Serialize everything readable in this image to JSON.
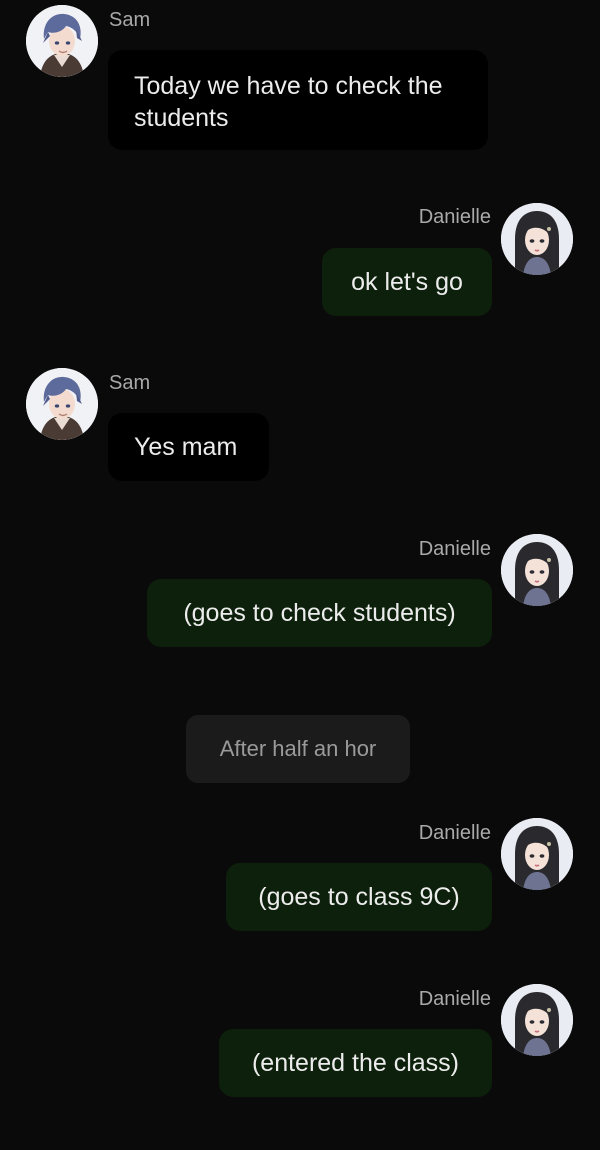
{
  "characters": {
    "sam": {
      "name": "Sam",
      "avatar_icon": "anime-boy-avatar"
    },
    "danielle": {
      "name": "Danielle",
      "avatar_icon": "anime-girl-avatar"
    }
  },
  "messages": [
    {
      "speaker": "Sam",
      "text": "Today we have to check the students",
      "side": "left"
    },
    {
      "speaker": "Danielle",
      "text": "ok let's go",
      "side": "right"
    },
    {
      "speaker": "Sam",
      "text": "Yes mam",
      "side": "left"
    },
    {
      "speaker": "Danielle",
      "text": "(goes to check students)",
      "side": "right"
    },
    {
      "speaker": "",
      "text": "After half an hor",
      "side": "center"
    },
    {
      "speaker": "Danielle",
      "text": "(goes to class 9C)",
      "side": "right"
    },
    {
      "speaker": "Danielle",
      "text": "(entered the class)",
      "side": "right"
    }
  ],
  "colors": {
    "background": "#0a0a0a",
    "left_bubble": "#000000",
    "right_bubble": "#0d200b",
    "narration_bubble": "#1b1b1b",
    "name_text": "#a9a9a9"
  }
}
